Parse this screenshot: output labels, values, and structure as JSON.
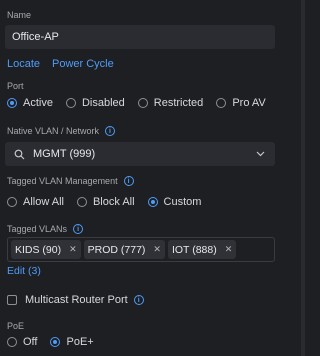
{
  "name": {
    "label": "Name",
    "value": "Office-AP"
  },
  "actions": {
    "locate": "Locate",
    "power_cycle": "Power Cycle"
  },
  "port": {
    "label": "Port",
    "options": [
      "Active",
      "Disabled",
      "Restricted",
      "Pro AV"
    ],
    "selected": "Active"
  },
  "native_vlan": {
    "label": "Native VLAN / Network",
    "value": "MGMT (999)"
  },
  "tagged_mgmt": {
    "label": "Tagged VLAN Management",
    "options": [
      "Allow All",
      "Block All",
      "Custom"
    ],
    "selected": "Custom"
  },
  "tagged_vlans": {
    "label": "Tagged VLANs",
    "tags": [
      "KIDS (90)",
      "PROD (777)",
      "IOT (888)"
    ],
    "edit": "Edit (3)"
  },
  "multicast": {
    "label": "Multicast Router Port",
    "checked": false
  },
  "poe": {
    "label": "PoE",
    "options": [
      "Off",
      "PoE+"
    ],
    "selected": "PoE+"
  },
  "colors": {
    "accent": "#4f9cf7",
    "background": "#1e1f23"
  }
}
